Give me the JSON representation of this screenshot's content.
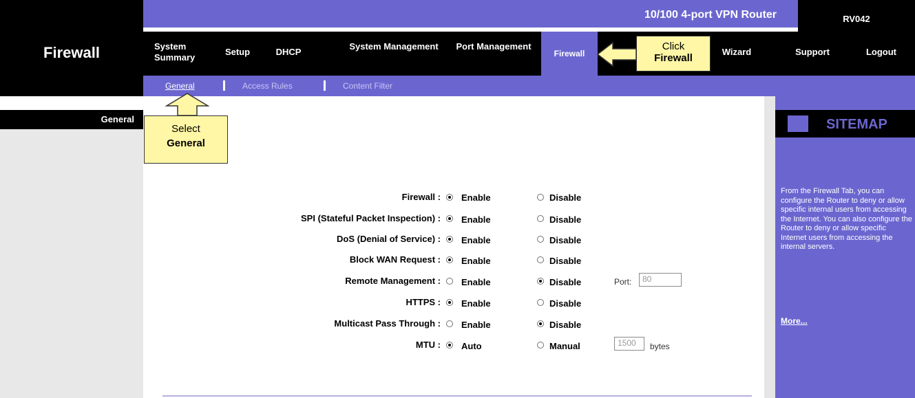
{
  "header": {
    "page_title": "Firewall",
    "product_name": "10/100 4-port VPN Router",
    "model": "RV042"
  },
  "nav": {
    "items": [
      {
        "label": "System Summary",
        "active": false
      },
      {
        "label": "Setup",
        "active": false
      },
      {
        "label": "DHCP",
        "active": false
      },
      {
        "label": "System Management",
        "active": false
      },
      {
        "label": "Port Management",
        "active": false
      },
      {
        "label": "Firewall",
        "active": true
      },
      {
        "label": "Wizard",
        "active": false
      },
      {
        "label": "Support",
        "active": false
      },
      {
        "label": "Logout",
        "active": false
      }
    ]
  },
  "subnav": {
    "items": [
      {
        "label": "General",
        "active": true
      },
      {
        "label": "Access Rules",
        "active": false
      },
      {
        "label": "Content Filter",
        "active": false
      }
    ]
  },
  "left": {
    "section_label": "General"
  },
  "callouts": {
    "click": {
      "line1": "Click",
      "line2": "Firewall"
    },
    "select": {
      "line1": "Select",
      "line2": "General"
    }
  },
  "form": {
    "rows": [
      {
        "label": "Firewall :",
        "options": [
          "Enable",
          "Disable"
        ],
        "selected": 0
      },
      {
        "label": "SPI (Stateful Packet Inspection) :",
        "options": [
          "Enable",
          "Disable"
        ],
        "selected": 0
      },
      {
        "label": "DoS (Denial of Service) :",
        "options": [
          "Enable",
          "Disable"
        ],
        "selected": 0
      },
      {
        "label": "Block WAN Request :",
        "options": [
          "Enable",
          "Disable"
        ],
        "selected": 0
      },
      {
        "label": "Remote Management :",
        "options": [
          "Enable",
          "Disable"
        ],
        "selected": 1,
        "extra_label": "Port:",
        "extra_value": "80"
      },
      {
        "label": "HTTPS :",
        "options": [
          "Enable",
          "Disable"
        ],
        "selected": 0
      },
      {
        "label": "Multicast Pass Through :",
        "options": [
          "Enable",
          "Disable"
        ],
        "selected": 1
      },
      {
        "label": "MTU :",
        "options": [
          "Auto",
          "Manual"
        ],
        "selected": 0,
        "extra_value": "1500",
        "extra_unit": "bytes"
      }
    ]
  },
  "sitemap": {
    "title": "SITEMAP",
    "body": "From the Firewall Tab, you can configure the Router to deny or allow specific internal users from accessing the Internet. You can also configure the Router to deny or allow specific Internet users from accessing the internal servers.",
    "more": "More..."
  },
  "colors": {
    "accent": "#6b66cf",
    "black": "#000000",
    "callout": "#fff7a6"
  }
}
